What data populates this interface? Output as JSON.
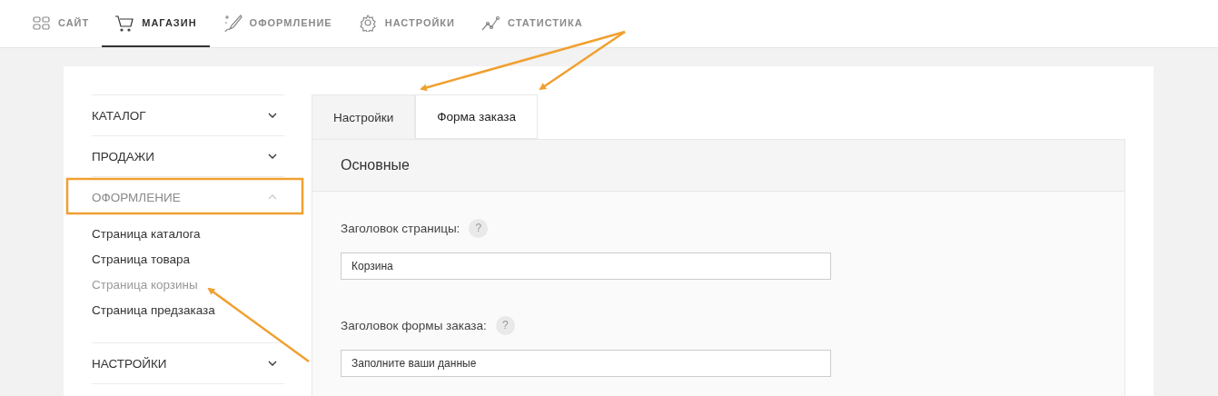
{
  "top_nav": [
    {
      "label": "САЙТ",
      "selected": false
    },
    {
      "label": "МАГАЗИН",
      "selected": true
    },
    {
      "label": "ОФОРМЛЕНИЕ",
      "selected": false
    },
    {
      "label": "НАСТРОЙКИ",
      "selected": false
    },
    {
      "label": "СТАТИСТИКА",
      "selected": false
    }
  ],
  "sidebar": {
    "items": [
      {
        "label": "КАТАЛОГ",
        "expanded": false
      },
      {
        "label": "ПРОДАЖИ",
        "expanded": false
      },
      {
        "label": "ОФОРМЛЕНИЕ",
        "expanded": true,
        "children": [
          {
            "label": "Страница каталога",
            "selected": false
          },
          {
            "label": "Страница товара",
            "selected": false
          },
          {
            "label": "Страница корзины",
            "selected": true
          },
          {
            "label": "Страница предзаказа",
            "selected": false
          }
        ]
      },
      {
        "label": "НАСТРОЙКИ",
        "expanded": false
      }
    ]
  },
  "tabs": [
    {
      "label": "Настройки",
      "selected": true
    },
    {
      "label": "Форма заказа",
      "selected": false
    }
  ],
  "section": {
    "title": "Основные",
    "fields": [
      {
        "label": "Заголовок страницы:",
        "help": "?",
        "value": "Корзина"
      },
      {
        "label": "Заголовок формы заказа:",
        "help": "?",
        "value": "Заполните ваши данные"
      }
    ]
  }
}
